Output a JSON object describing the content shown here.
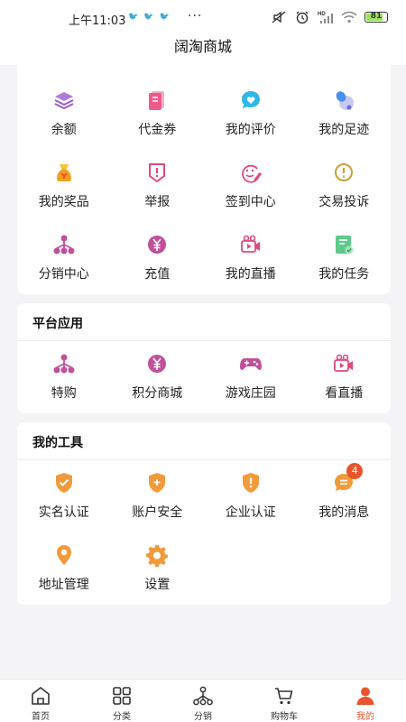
{
  "status_bar": {
    "time": "上午11:03",
    "notification_icons": [
      "bird-icon",
      "bird-icon",
      "bird-icon"
    ],
    "more": "···",
    "battery": "81",
    "network": "HD"
  },
  "header": {
    "title": "阔淘商城"
  },
  "top_grid": {
    "items": [
      {
        "label": "余额",
        "icon": "layers-icon"
      },
      {
        "label": "代金券",
        "icon": "coupon-icon"
      },
      {
        "label": "我的评价",
        "icon": "heart-chat-icon"
      },
      {
        "label": "我的足迹",
        "icon": "footprint-icon"
      },
      {
        "label": "我的奖品",
        "icon": "prize-bag-icon"
      },
      {
        "label": "举报",
        "icon": "report-icon"
      },
      {
        "label": "签到中心",
        "icon": "smile-pen-icon"
      },
      {
        "label": "交易投诉",
        "icon": "complaint-icon"
      },
      {
        "label": "分销中心",
        "icon": "network-icon"
      },
      {
        "label": "充值",
        "icon": "yen-coin-icon"
      },
      {
        "label": "我的直播",
        "icon": "video-camera-icon"
      },
      {
        "label": "我的任务",
        "icon": "task-doc-icon"
      }
    ]
  },
  "platform_section": {
    "title": "平台应用",
    "items": [
      {
        "label": "特购",
        "icon": "network-icon"
      },
      {
        "label": "积分商城",
        "icon": "yen-coin-icon"
      },
      {
        "label": "游戏庄园",
        "icon": "gamepad-icon"
      },
      {
        "label": "看直播",
        "icon": "video-camera-icon"
      }
    ]
  },
  "tools_section": {
    "title": "我的工具",
    "items": [
      {
        "label": "实名认证",
        "icon": "shield-check-icon"
      },
      {
        "label": "账户安全",
        "icon": "shield-plus-icon"
      },
      {
        "label": "企业认证",
        "icon": "shield-alert-icon"
      },
      {
        "label": "我的消息",
        "icon": "message-icon",
        "badge": "4"
      },
      {
        "label": "地址管理",
        "icon": "location-pin-icon"
      },
      {
        "label": "设置",
        "icon": "gear-icon"
      }
    ]
  },
  "tab_bar": {
    "tabs": [
      {
        "label": "首页",
        "icon": "home-icon"
      },
      {
        "label": "分类",
        "icon": "grid-icon"
      },
      {
        "label": "分销",
        "icon": "network-icon"
      },
      {
        "label": "购物车",
        "icon": "cart-icon"
      },
      {
        "label": "我的",
        "icon": "user-icon",
        "active": true
      }
    ]
  },
  "colors": {
    "accent": "#e9542c",
    "purple": "#9b5ac8",
    "pink": "#e0487f",
    "orange": "#f29a3a",
    "page_bg": "#f4f4f6"
  }
}
